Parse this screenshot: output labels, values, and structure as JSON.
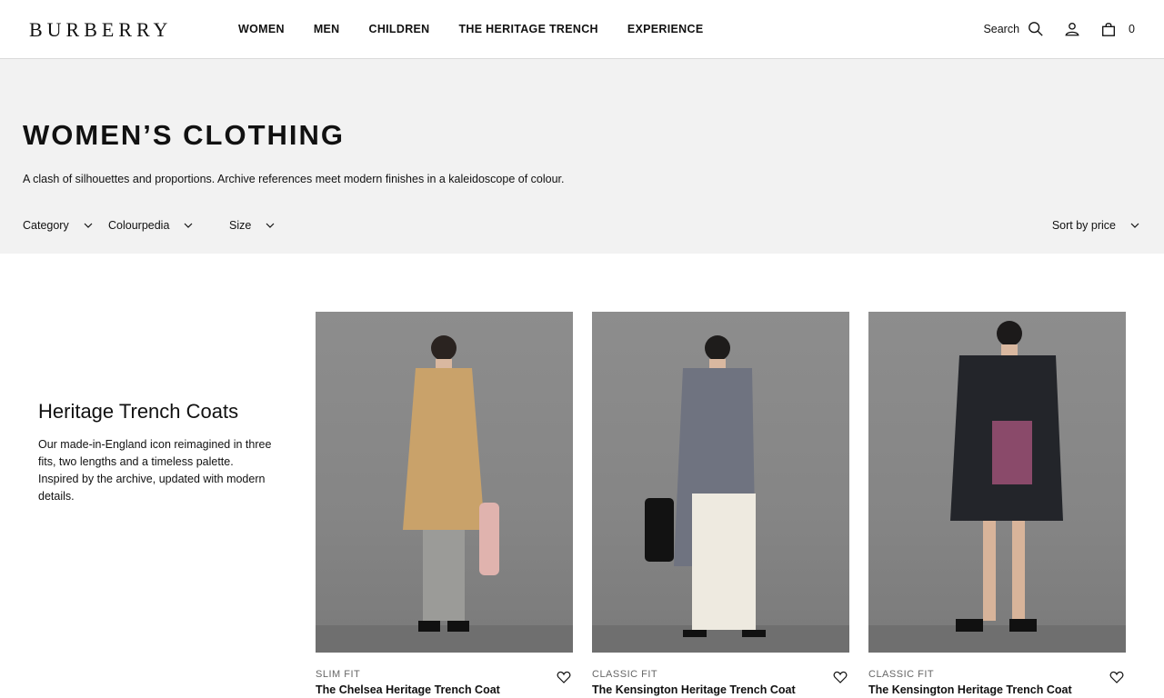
{
  "header": {
    "logo": "BURBERRY",
    "nav": [
      "WOMEN",
      "MEN",
      "CHILDREN",
      "THE HERITAGE TRENCH",
      "EXPERIENCE"
    ],
    "search_label": "Search",
    "bag_count": "0",
    "icons": [
      "search-icon",
      "account-icon",
      "bag-icon"
    ]
  },
  "hero": {
    "title": "WOMEN’S CLOTHING",
    "description": "A clash of silhouettes and proportions. Archive references meet modern finishes in a kaleidoscope of colour.",
    "filters": [
      "Category",
      "Colourpedia",
      "Size"
    ],
    "sort_label": "Sort by price"
  },
  "promo": {
    "title": "Heritage Trench Coats",
    "text": "Our made-in-England icon reimagined in three fits, two lengths and a timeless palette. Inspired by the archive, updated with modern details."
  },
  "products": [
    {
      "fit": "SLIM FIT",
      "name": "The Chelsea Heritage Trench Coat",
      "coat_color": "#c9a26a"
    },
    {
      "fit": "CLASSIC FIT",
      "name": "The Kensington Heritage Trench Coat",
      "coat_color": "#6f7380"
    },
    {
      "fit": "CLASSIC FIT",
      "name": "The Kensington Heritage Trench Coat",
      "coat_color": "#23252a"
    }
  ],
  "colors": {
    "hero_bg": "#f2f2f2",
    "text": "#111111",
    "muted": "#666666"
  }
}
